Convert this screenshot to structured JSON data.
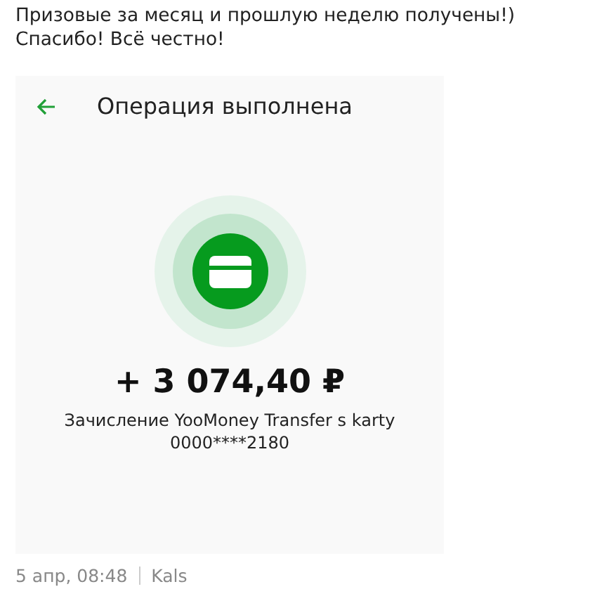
{
  "post": {
    "text": "Призовые за месяц и прошлую неделю получены!) Спасибо! Всё честно!"
  },
  "screenshot": {
    "title": "Операция выполнена",
    "amount": "+ 3 074,40 ₽",
    "description": "Зачисление YooMoney Transfer s karty 0000****2180"
  },
  "footer": {
    "date": "5 апр, 08:48",
    "author": "Kals"
  }
}
